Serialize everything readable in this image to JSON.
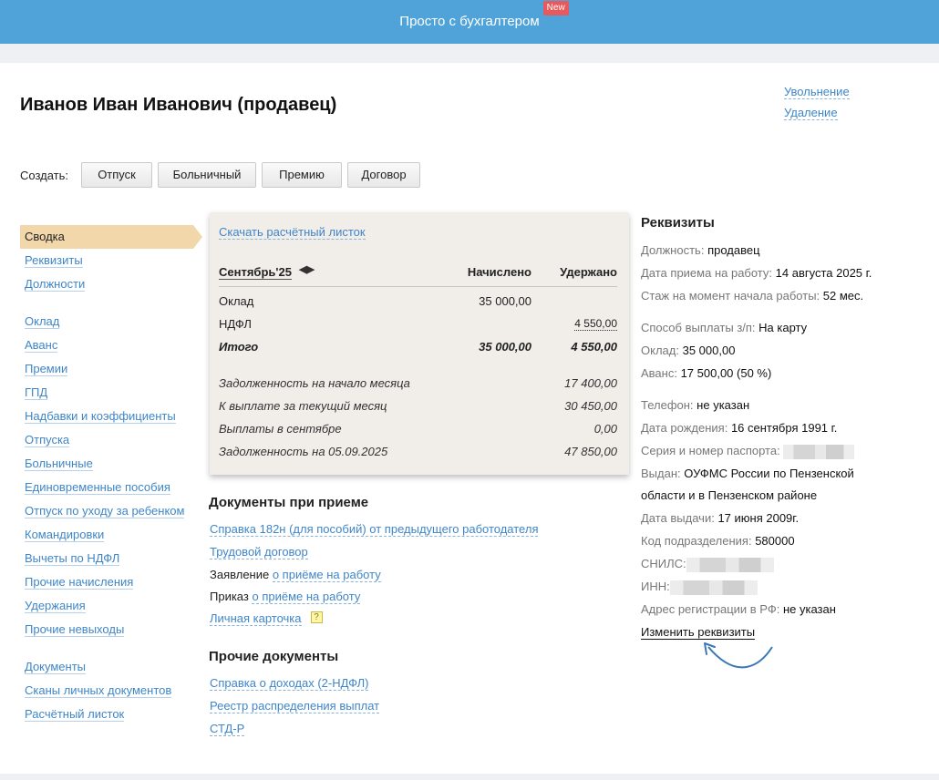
{
  "topbar": {
    "title": "Просто с бухгалтером",
    "badge": "New"
  },
  "employee": {
    "name": "Иванов Иван Иванович (продавец)"
  },
  "top_actions": {
    "dismissal": "Увольнение",
    "delete": "Удаление"
  },
  "create": {
    "label": "Создать:",
    "buttons": [
      "Отпуск",
      "Больничный",
      "Премию",
      "Договор"
    ]
  },
  "sidebar": {
    "group1": [
      "Сводка",
      "Реквизиты",
      "Должности"
    ],
    "group2": [
      "Оклад",
      "Аванс",
      "Премии",
      "ГПД",
      "Надбавки и коэффициенты",
      "Отпуска",
      "Больничные",
      "Единовременные пособия",
      "Отпуск по уходу за ребенком",
      "Командировки",
      "Вычеты по НДФЛ",
      "Прочие начисления",
      "Удержания",
      "Прочие невыходы"
    ],
    "group3": [
      "Документы",
      "Сканы личных документов",
      "Расчётный листок"
    ]
  },
  "payslip": {
    "download": "Скачать расчётный листок",
    "month": "Сентябрь'25",
    "col_accrued": "Начислено",
    "col_withheld": "Удержано",
    "rows": [
      {
        "name": "Оклад",
        "accrued": "35 000,00",
        "withheld": ""
      },
      {
        "name": "НДФЛ",
        "accrued": "",
        "withheld": "4 550,00"
      }
    ],
    "total": {
      "name": "Итого",
      "accrued": "35 000,00",
      "withheld": "4 550,00"
    },
    "summary": [
      {
        "name": "Задолженность на начало месяца",
        "value": "17 400,00"
      },
      {
        "name": "К выплате за текущий месяц",
        "value": "30 450,00"
      },
      {
        "name": "Выплаты в сентябре",
        "value": "0,00"
      },
      {
        "name": "Задолженность на 05.09.2025",
        "value": "47 850,00"
      }
    ]
  },
  "hiring_docs": {
    "title": "Документы при приеме",
    "items": {
      "spravka": "Справка 182н (для пособий) от предыдущего работодателя",
      "contract": "Трудовой договор",
      "statement_prefix": "Заявление",
      "statement_link": "о приёме на работу",
      "order_prefix": "Приказ",
      "order_link": "о приёме на работу",
      "card": "Личная карточка",
      "help": "?"
    }
  },
  "other_docs": {
    "title": "Прочие документы",
    "items": [
      "Справка о доходах (2-НДФЛ)",
      "Реестр распределения выплат",
      "СТД-Р"
    ]
  },
  "requisites": {
    "title": "Реквизиты",
    "position_k": "Должность:",
    "position_v": "продавец",
    "hire_k": "Дата приема на работу:",
    "hire_v": "14 августа 2025 г.",
    "exp_k": "Стаж на момент начала работы:",
    "exp_v": "52 мес.",
    "pay_k": "Способ выплаты з/п:",
    "pay_v": "На карту",
    "salary_k": "Оклад:",
    "salary_v": "35 000,00",
    "advance_k": "Аванс:",
    "advance_v": "17 500,00 (50 %)",
    "phone_k": "Телефон:",
    "phone_v": "не указан",
    "birth_k": "Дата рождения:",
    "birth_v": "16 сентября 1991 г.",
    "passport_k": "Серия и номер паспорта:",
    "issued_k": "Выдан:",
    "issued_v1": "ОУФМС России по Пензенской",
    "issued_v2": "области и в Пензенском районе",
    "issue_date_k": "Дата выдачи:",
    "issue_date_v": "17 июня 2009г.",
    "code_k": "Код подразделения:",
    "code_v": "580000",
    "snils_k": "СНИЛС:",
    "inn_k": "ИНН:",
    "address_k": "Адрес регистрации в РФ:",
    "address_v": "не указан",
    "change": "Изменить реквизиты"
  },
  "colors": {
    "topbar": "#4fa3d9",
    "link": "#3f86c8",
    "active_item": "#f2d7aa",
    "badge": "#e8595d"
  }
}
